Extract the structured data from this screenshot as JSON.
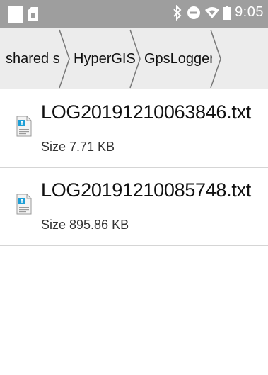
{
  "status_bar": {
    "time": "9:05",
    "icons": [
      "sim-card-icon",
      "sd-card-icon",
      "bluetooth-icon",
      "do-not-disturb-icon",
      "wifi-icon",
      "battery-icon"
    ]
  },
  "breadcrumb": {
    "items": [
      {
        "label": "shared s"
      },
      {
        "label": "HyperGIS"
      },
      {
        "label": "GpsLogger"
      }
    ]
  },
  "files": [
    {
      "name": "LOG20191210063846.txt",
      "size": "Size 7.71 KB",
      "icon": "text-file-icon"
    },
    {
      "name": "LOG20191210085748.txt",
      "size": "Size 895.86 KB",
      "icon": "text-file-icon"
    }
  ],
  "colors": {
    "status_bar_bg": "#9e9e9e",
    "breadcrumb_bg": "#ececec",
    "file_icon_accent": "#1e9fd6"
  }
}
